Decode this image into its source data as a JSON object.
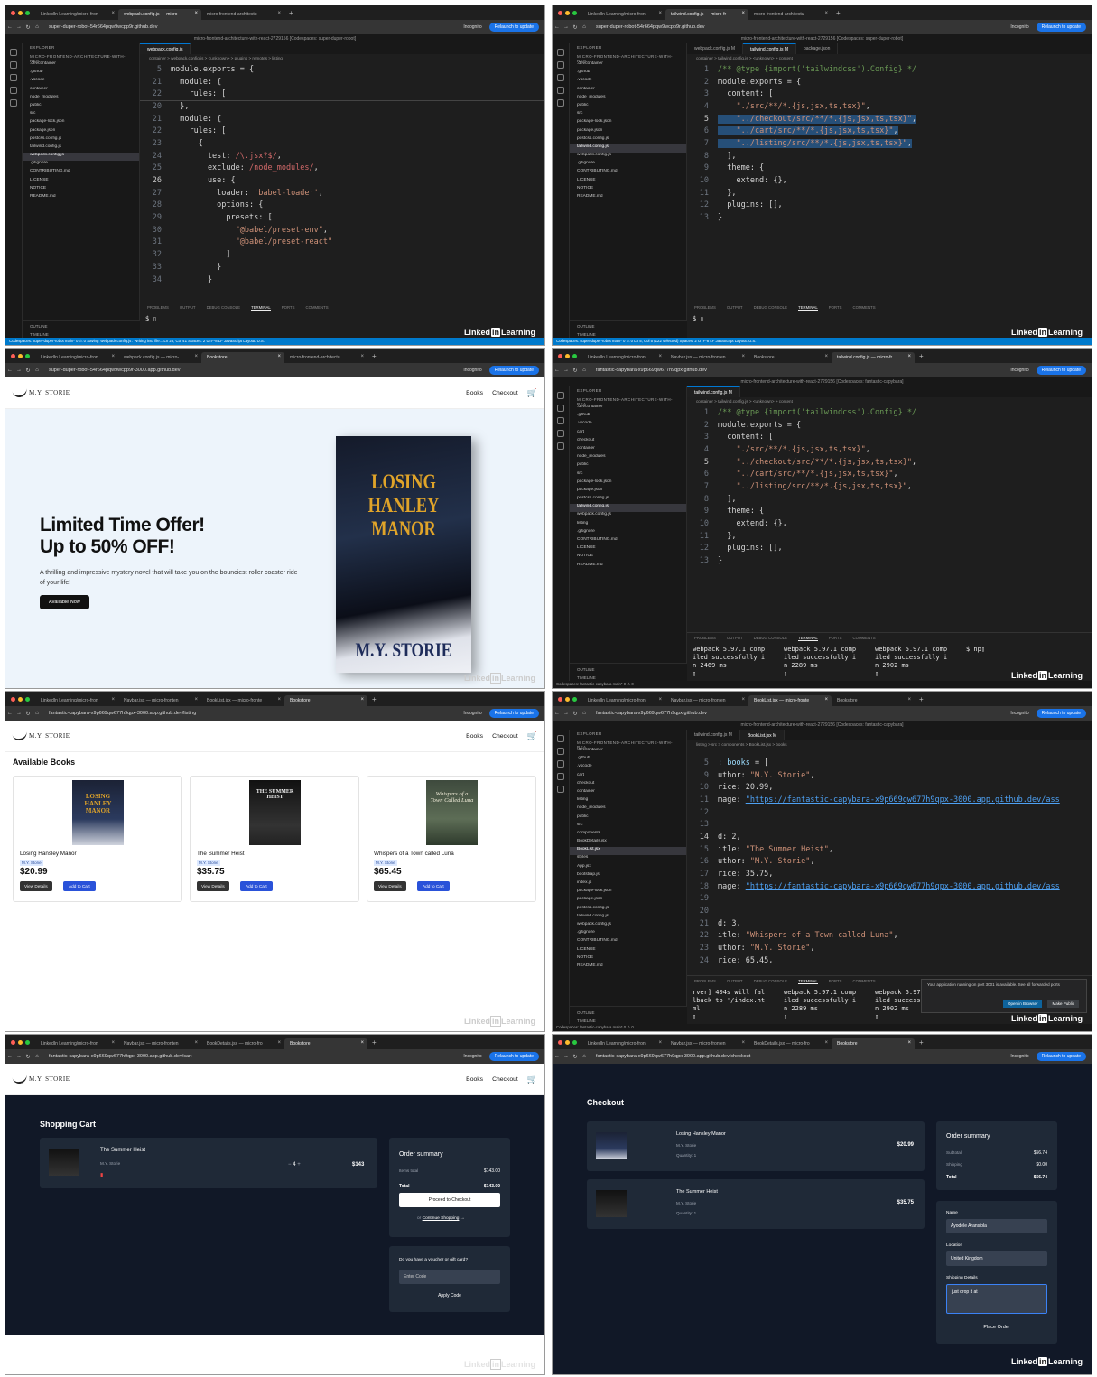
{
  "browser": {
    "tab_linkedin": "LinkedIn Learning/micro-fron",
    "tab_webpack": "webpack.config.js — micro-",
    "tab_micro": "micro-frontend-architectu",
    "tab_tailwind": "tailwind.config.js — micro-fr",
    "tab_bookstore": "Bookstore",
    "tab_navbar": "Navbar.jsx — micro-fronten",
    "tab_booklist": "BookList.jsx — micro-fronte",
    "tab_bookdetails": "BookDetails.jsx — micro-fro",
    "incognito": "Incognito",
    "relaunch": "Relaunch to update"
  },
  "urls": {
    "p1": "super-duper-robot-54r664pqw9wcpp9r.github.dev",
    "p3": "super-duper-robot-54r664pqw9wcpp9r-3000.app.github.dev",
    "p4": "fantastic-capybara-x9p669qw677h9qpx.github.dev",
    "p5": "fantastic-capybara-x9p669qw677h9qpx-3000.app.github.dev/listing",
    "p7": "fantastic-capybara-x9p669qw677h9qpx-3000.app.github.dev/cart",
    "p8": "fantastic-capybara-x9p669qw677h9qpx-3000.app.github.dev/checkout"
  },
  "vscode": {
    "search1": "micro-frontend-architecture-with-react-2729156 [Codespaces: super-duper-robot]",
    "search2": "micro-frontend-architecture-with-react-2729156 [Codespaces: fantastic-capybara]",
    "explorer": "EXPLORER",
    "repo": "MICRO-FRONTEND-ARCHITECTURE-WITH-REA...",
    "outline": "OUTLINE",
    "timeline": "TIMELINE",
    "term_tabs": [
      "PROBLEMS",
      "OUTPUT",
      "DEBUG CONSOLE",
      "TERMINAL",
      "PORTS",
      "COMMENTS"
    ],
    "files1": [
      ".devcontainer",
      ".github",
      ".vscode",
      "container",
      "node_modules",
      "public",
      "src",
      "package-lock.json",
      "package.json",
      "postcss.config.js",
      "tailwind.config.js",
      "webpack.config.js",
      ".gitignore",
      "CONTRIBUTING.md",
      "LICENSE",
      "NOTICE",
      "README.md"
    ],
    "files4": [
      ".devcontainer",
      ".github",
      ".vscode",
      "cart",
      "checkout",
      "container",
      "node_modules",
      "public",
      "src",
      "package-lock.json",
      "package.json",
      "postcss.config.js",
      "tailwind.config.js",
      "webpack.config.js",
      "listing",
      ".gitignore",
      "CONTRIBUTING.md",
      "LICENSE",
      "NOTICE",
      "README.md"
    ],
    "files6": [
      ".devcontainer",
      ".github",
      ".vscode",
      "cart",
      "checkout",
      "container",
      "listing",
      "node_modules",
      "public",
      "src",
      "components",
      "BookDetails.jsx",
      "BookList.jsx",
      "styles",
      "App.jsx",
      "bootstrap.js",
      "index.js",
      "package-lock.json",
      "package.json",
      "postcss.config.js",
      "tailwind.config.js",
      "webpack.config.js",
      ".gitignore",
      "CONTRIBUTING.md",
      "LICENSE",
      "NOTICE",
      "README.md"
    ],
    "tab_webpack": "webpack.config.js",
    "tab_tailwind": "tailwind.config.js M",
    "tab_webpack_m": "webpack.config.js M",
    "tab_package": "package.json",
    "tab_booklist": "BookList.jsx M",
    "crumb1": "container > webpack.config.js > <unknown> > plugins > remotes > listing",
    "crumb2": "container > tailwind.config.js > <unknown> > content",
    "crumb6": "listing > src > components > BookList.jsx > books",
    "status1": "Codespaces: super-duper-robot    main*   0 ⚠ 0   Saving 'webpack.config.js': Writing into file...      Ln 26, Col 41  Spaces: 2  UTF-8  LF  JavaScript  Layout: U.S.",
    "status2": "Codespaces: super-duper-robot    main*   0 ⚠ 0      Ln 5, Col 5 (122 selected)  Spaces: 2  UTF-8  LF  JavaScript  Layout: U.S.",
    "status4": "Codespaces: fantastic-capybara   main*   0 ⚠ 0",
    "prompt": "$ ▯",
    "prompt4": "$ np▯",
    "term4": [
      "webpack 5.97.1 comp\niled successfully i\nn 2469 ms\n▯",
      "webpack 5.97.1 comp\niled successfully i\nn 2289 ms\n▯",
      "webpack 5.97.1 comp\niled successfully i\nn 2902 ms\n▯"
    ],
    "term6": [
      "rver] 404s will fal\nlback to '/index.ht\nml'\n▯",
      "webpack 5.97.1 comp\niled successfully i\nn 2289 ms\n▯",
      "webpack 5.97\niled success\nn 2902 ms\n▯"
    ],
    "notif": "Your application running on port 3001 is available. See all forwarded ports",
    "open_browser": "Open in Browser",
    "make_public": "Make Public",
    "side_bash": "bash - container",
    "linkedin": "Linked",
    "learning": "Learning"
  },
  "store": {
    "brand": "M.Y. STORIE",
    "nav_books": "Books",
    "nav_checkout": "Checkout",
    "hero_title1": "Limited Time Offer!",
    "hero_title2": "Up to 50% OFF!",
    "hero_desc": "A thrilling and impressive mystery novel that will take you on the bounciest roller coaster ride of your life!",
    "hero_btn": "Available Now",
    "cover_title": "LOSING HANLEY MANOR",
    "cover_author": "M.Y. STORIE",
    "available": "Available Books",
    "view_details": "View Details",
    "add_to_cart": "Add to Cart",
    "books": [
      {
        "title": "Losing Hansley Manor",
        "author": "M.Y. Storie",
        "price": "$20.99"
      },
      {
        "title": "The Summer Heist",
        "author": "M.Y. Storie",
        "price": "$35.75"
      },
      {
        "title": "Whispers of a Town called Luna",
        "author": "M.Y. Storie",
        "price": "$65.45"
      }
    ],
    "cover_summer": "THE SUMMER HEIST",
    "cover_whispers": "Whispers of a Town Called Luna"
  },
  "cart": {
    "title": "Shopping Cart",
    "item_title": "The Summer Heist",
    "item_author": "M.Y. Storie",
    "qty": "4",
    "item_total": "$143",
    "summary": "Order summary",
    "items_total_label": "Items total",
    "items_total": "$143.00",
    "total_label": "Total",
    "total": "$143.00",
    "proceed": "Proceed to Checkout",
    "or": "or",
    "continue": "Continue Shopping",
    "voucher_q": "Do you have a voucher or gift card?",
    "voucher_ph": "Enter Code",
    "apply": "Apply Code"
  },
  "checkout": {
    "title": "Checkout",
    "items": [
      {
        "title": "Losing Hansley Manor",
        "author": "M.Y. Storie",
        "qty": "Quantity: 1",
        "price": "$20.99"
      },
      {
        "title": "The Summer Heist",
        "author": "M.Y. Storie",
        "qty": "Quantity: 1",
        "price": "$35.75"
      }
    ],
    "summary": "Order summary",
    "subtotal_label": "Subtotal",
    "subtotal": "$56.74",
    "shipping_label": "Shipping",
    "shipping": "$0.00",
    "total_label": "Total",
    "total": "$56.74",
    "name_label": "Name",
    "name": "Ayodele Aransiola",
    "location_label": "Location",
    "location": "United Kingdom",
    "shipping_details_label": "Shipping Details",
    "shipping_details": "just drop it at",
    "place_order": "Place Order"
  }
}
